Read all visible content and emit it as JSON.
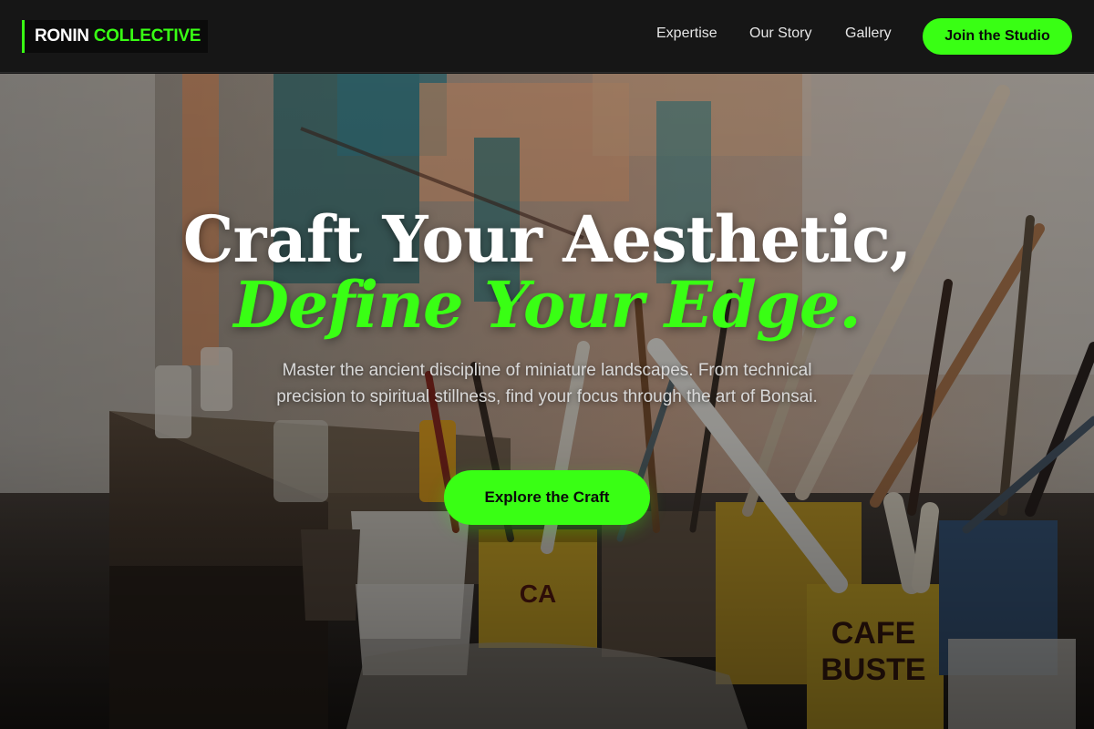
{
  "header": {
    "logo_word1": "RONIN",
    "logo_word2": "COLLECTIVE",
    "nav": [
      {
        "label": "Expertise"
      },
      {
        "label": "Our Story"
      },
      {
        "label": "Gallery"
      }
    ],
    "cta_label": "Join the Studio"
  },
  "hero": {
    "title_line1": "Craft Your Aesthetic,",
    "title_line2": "Define Your Edge.",
    "subtitle": "Master the ancient discipline of miniature landscapes. From technical precision to spiritual stillness, find your focus through the art of Bonsai.",
    "cta_label": "Explore the Craft",
    "background_image_desc": "Dimmed photo of an artist's workbench with paint cans and brushes"
  },
  "colors": {
    "accent": "#39ff14",
    "header_bg": "#161616",
    "text": "#ffffff"
  }
}
